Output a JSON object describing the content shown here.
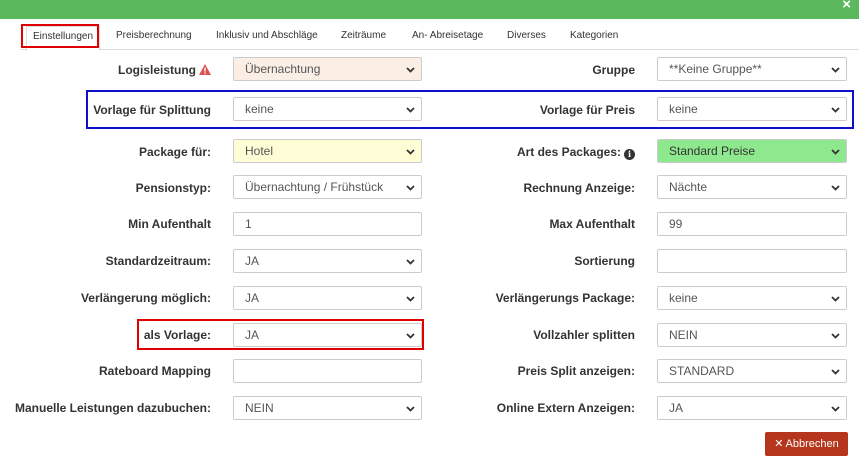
{
  "window": {
    "close_glyph": "×"
  },
  "tabs": [
    {
      "label": "Einstellungen"
    },
    {
      "label": "Preisberechnung"
    },
    {
      "label": "Inklusiv und Abschläge"
    },
    {
      "label": "Zeiträume"
    },
    {
      "label": "An- Abreisetage"
    },
    {
      "label": "Diverses"
    },
    {
      "label": "Kategorien"
    }
  ],
  "form": {
    "left": {
      "logisleistung": {
        "label": "Logisleistung",
        "value": "Übernachtung"
      },
      "vorlage_splittung": {
        "label": "Vorlage für Splittung",
        "value": "keine"
      },
      "package_fuer": {
        "label": "Package für:",
        "value": "Hotel"
      },
      "pensionstyp": {
        "label": "Pensionstyp:",
        "value": "Übernachtung / Frühstück"
      },
      "min_aufenthalt": {
        "label": "Min Aufenthalt",
        "value": "1"
      },
      "standardzeitraum": {
        "label": "Standardzeitraum:",
        "value": "JA"
      },
      "verlaengerung": {
        "label": "Verlängerung möglich:",
        "value": "JA"
      },
      "als_vorlage": {
        "label": "als Vorlage:",
        "value": "JA"
      },
      "rateboard": {
        "label": "Rateboard Mapping",
        "value": ""
      },
      "manuelle": {
        "label": "Manuelle Leistungen dazubuchen:",
        "value": "NEIN"
      }
    },
    "right": {
      "gruppe": {
        "label": "Gruppe",
        "value": "**Keine Gruppe**"
      },
      "vorlage_preis": {
        "label": "Vorlage für Preis",
        "value": "keine"
      },
      "art_packages": {
        "label": "Art des Packages:",
        "value": "Standard Preise"
      },
      "rechnung": {
        "label": "Rechnung Anzeige:",
        "value": "Nächte"
      },
      "max_aufenthalt": {
        "label": "Max Aufenthalt",
        "value": "99"
      },
      "sortierung": {
        "label": "Sortierung",
        "value": ""
      },
      "verlaengerungs_package": {
        "label": "Verlängerungs Package:",
        "value": "keine"
      },
      "vollzahler": {
        "label": "Vollzahler splitten",
        "value": "NEIN"
      },
      "preis_split": {
        "label": "Preis Split anzeigen:",
        "value": "STANDARD"
      },
      "online_extern": {
        "label": "Online Extern Anzeigen:",
        "value": "JA"
      }
    }
  },
  "footer": {
    "cancel_label": "Abbrechen",
    "cancel_glyph": "✕"
  },
  "colors": {
    "header_green": "#5cb85c",
    "highlight_red": "#e00000",
    "highlight_blue": "#1010c8",
    "cancel_button": "#b5361c",
    "package_yellow": "#fffdd6",
    "art_green": "#8ee88e"
  },
  "icons": {
    "warning": "warning-icon",
    "info": "info-icon",
    "dropdown": "chevron-down-icon",
    "close": "close-icon"
  }
}
